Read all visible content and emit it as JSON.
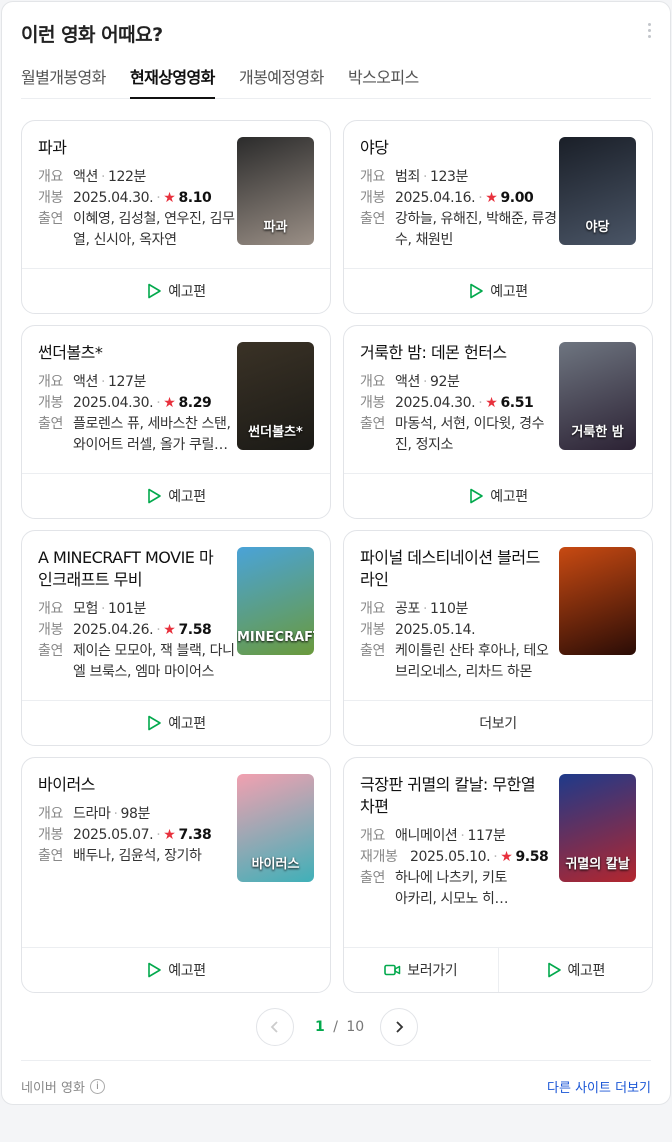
{
  "header": {
    "title": "이런 영화 어때요?"
  },
  "tabs": [
    "월별개봉영화",
    "현재상영영화",
    "개봉예정영화",
    "박스오피스"
  ],
  "labels": {
    "genre": "개요",
    "release": "개봉",
    "rerelease": "재개봉",
    "cast": "출연",
    "trailer": "예고편",
    "more": "더보기",
    "watch": "보러가기"
  },
  "movies": [
    {
      "title": "파과",
      "genre": "액션",
      "runtime": "122분",
      "date": "2025.04.30.",
      "score": "8.10",
      "cast": "이혜영, 김성철, 연우진, 김무열, 신시아, 옥자연",
      "poster_text": "파과",
      "poster_colors": [
        "#2b2b2b",
        "#9a8f86"
      ]
    },
    {
      "title": "야당",
      "genre": "범죄",
      "runtime": "123분",
      "date": "2025.04.16.",
      "score": "9.00",
      "cast": "강하늘, 유해진, 박해준, 류경수, 채원빈",
      "poster_text": "야당",
      "poster_colors": [
        "#1a1f28",
        "#4a5566"
      ]
    },
    {
      "title": "썬더볼츠*",
      "genre": "액션",
      "runtime": "127분",
      "date": "2025.04.30.",
      "score": "8.29",
      "cast": "플로렌스 퓨, 세바스찬 스탠, 와이어트 러셀, 올가 쿠릴렌코",
      "poster_text": "썬더볼츠*",
      "poster_colors": [
        "#3a3226",
        "#1b1a16"
      ]
    },
    {
      "title": "거룩한 밤: 데몬 헌터스",
      "genre": "액션",
      "runtime": "92분",
      "date": "2025.04.30.",
      "score": "6.51",
      "cast": "마동석, 서현, 이다윗, 경수진, 정지소",
      "poster_text": "거룩한 밤",
      "poster_colors": [
        "#6e7580",
        "#2c2234"
      ]
    },
    {
      "title": "A MINECRAFT MOVIE 마인크래프트 무비",
      "genre": "모험",
      "runtime": "101분",
      "date": "2025.04.26.",
      "score": "7.58",
      "cast": "제이슨 모모아, 잭 블랙, 다니엘 브룩스, 엠마 마이어스",
      "poster_text": "MINECRAFT",
      "poster_colors": [
        "#4aa3d8",
        "#6a9a3c"
      ]
    },
    {
      "title": "파이널 데스티네이션 블러드라인",
      "genre": "공포",
      "runtime": "110분",
      "date": "2025.05.14.",
      "score": "",
      "cast": "케이틀린 산타 후아나, 테오 브리오네스, 리차드 하몬",
      "poster_text": "",
      "poster_colors": [
        "#c84a12",
        "#2a0c06"
      ]
    },
    {
      "title": "바이러스",
      "genre": "드라마",
      "runtime": "98분",
      "date": "2025.05.07.",
      "score": "7.38",
      "cast": "배두나, 김윤석, 장기하",
      "poster_text": "바이러스",
      "poster_colors": [
        "#f2a0b0",
        "#3fb0b8"
      ]
    },
    {
      "title": "극장판 귀멸의 칼날: 무한열차편",
      "genre": "애니메이션",
      "runtime": "117분",
      "date": "2025.05.10.",
      "score": "9.58",
      "cast": "하나에 나츠키, 키토 아카리, 시모노 히로, 마츠오카 요시츠구",
      "poster_text": "귀멸의 칼날",
      "poster_colors": [
        "#1e3a8a",
        "#b3262e"
      ]
    }
  ],
  "pager": {
    "current": "1",
    "total": "10"
  },
  "footer": {
    "source": "네이버 영화",
    "other_sites": "다른 사이트 더보기"
  },
  "colors": {
    "accent": "#03a94d",
    "star": "#e8313d",
    "link": "#1a56d6"
  }
}
